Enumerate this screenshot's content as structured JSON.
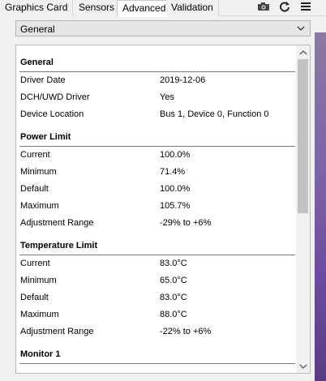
{
  "tabs": [
    {
      "label": "Graphics Card"
    },
    {
      "label": "Sensors"
    },
    {
      "label": "Advanced",
      "active": true
    },
    {
      "label": "Validation"
    }
  ],
  "toolbar": {
    "camera_icon": "camera-icon",
    "refresh_icon": "refresh-icon",
    "menu_icon": "hamburger-menu-icon"
  },
  "dropdown": {
    "selected": "General"
  },
  "sections": [
    {
      "title": "General",
      "rows": [
        {
          "key": "Driver Date",
          "value": "2019-12-06"
        },
        {
          "key": "DCH/UWD Driver",
          "value": "Yes"
        },
        {
          "key": "Device Location",
          "value": "Bus 1, Device 0, Function 0"
        }
      ]
    },
    {
      "title": "Power Limit",
      "rows": [
        {
          "key": "Current",
          "value": "100.0%"
        },
        {
          "key": "Minimum",
          "value": "71.4%"
        },
        {
          "key": "Default",
          "value": "100.0%"
        },
        {
          "key": "Maximum",
          "value": "105.7%"
        },
        {
          "key": "Adjustment Range",
          "value": "-29% to +6%"
        }
      ]
    },
    {
      "title": "Temperature Limit",
      "rows": [
        {
          "key": "Current",
          "value": "83.0°C"
        },
        {
          "key": "Minimum",
          "value": "65.0°C"
        },
        {
          "key": "Default",
          "value": "83.0°C"
        },
        {
          "key": "Maximum",
          "value": "88.0°C"
        },
        {
          "key": "Adjustment Range",
          "value": "-22% to +6%"
        }
      ]
    },
    {
      "title": "Monitor 1",
      "rows": []
    }
  ],
  "colors": {
    "window_bg": "#f0f0f0",
    "panel_bg": "#ffffff",
    "scroll_thumb": "#c2c2c2"
  }
}
